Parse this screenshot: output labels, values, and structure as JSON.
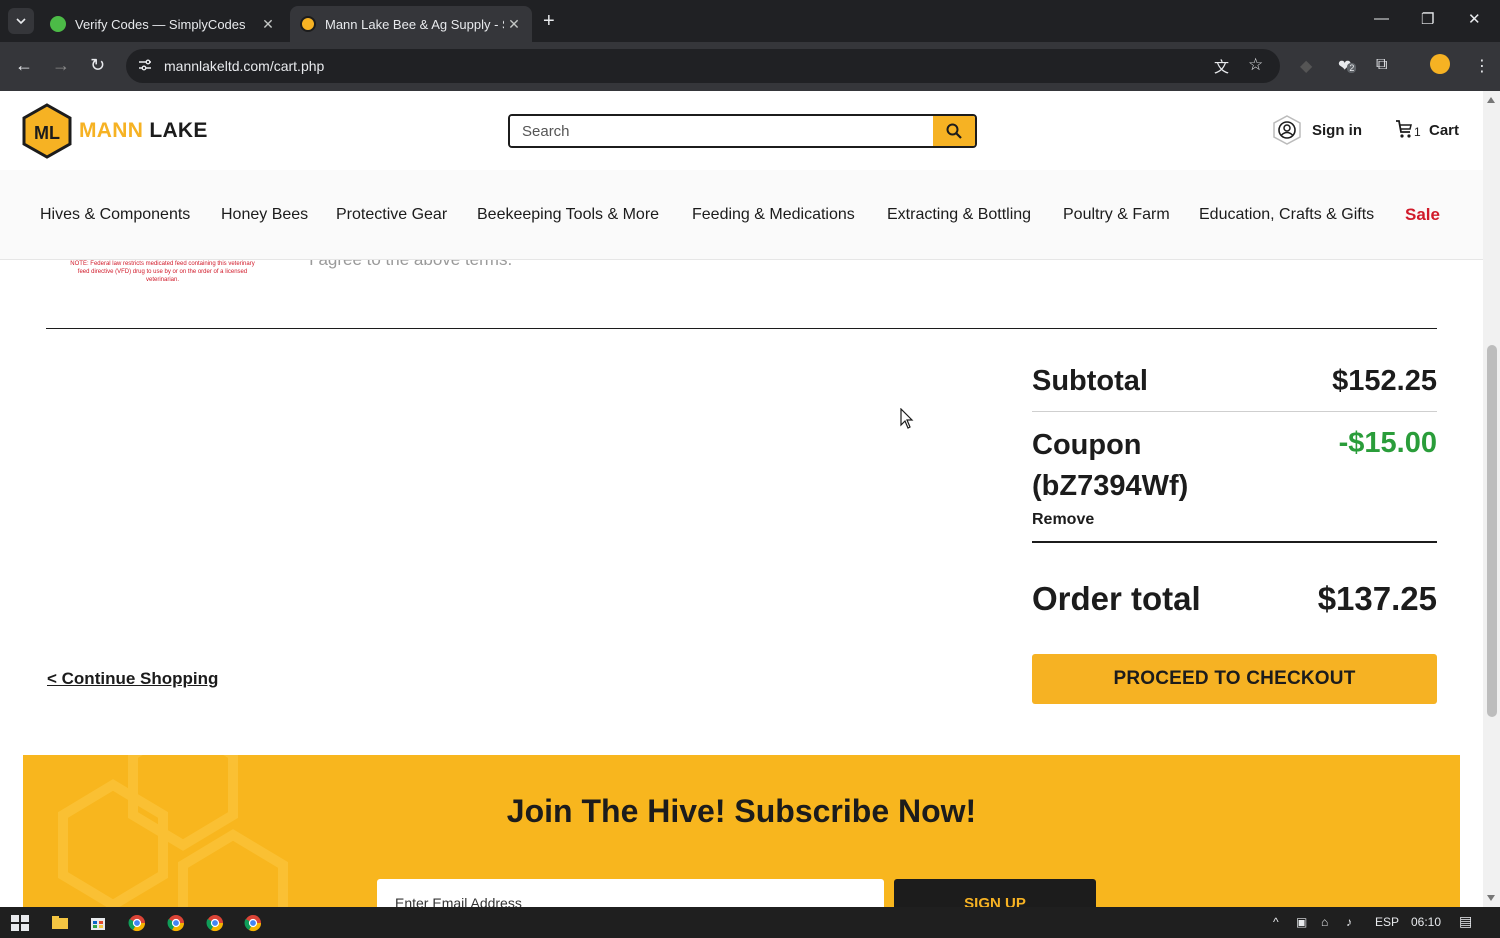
{
  "browser": {
    "tabs": [
      {
        "title": "Verify Codes — SimplyCodes",
        "favicon": "simplycodes-icon"
      },
      {
        "title": "Mann Lake Bee & Ag Supply - S",
        "favicon": "mannlake-icon"
      }
    ],
    "url": "mannlakeltd.com/cart.php",
    "extension_badge": "2"
  },
  "header": {
    "logo_initials": "ML",
    "logo_mann": "MANN",
    "logo_lake": "LAKE",
    "search_placeholder": "Search",
    "sign_in": "Sign in",
    "cart_label": "Cart",
    "cart_count": "1"
  },
  "nav": {
    "items": [
      "Hives & Components",
      "Honey Bees",
      "Protective Gear",
      "Beekeeping Tools & More",
      "Feeding & Medications",
      "Extracting & Bottling",
      "Poultry & Farm",
      "Education, Crafts & Gifts"
    ],
    "sale": "Sale"
  },
  "cart": {
    "vfd_note": "NOTE: Federal law restricts medicated feed containing this veterinary feed directive (VFD) drug to use by or on the order of a licensed veterinarian.",
    "agree_text": "I agree to the above terms.",
    "subtotal_label": "Subtotal",
    "subtotal_value": "$152.25",
    "coupon_label": "Coupon (bZ7394Wf)",
    "coupon_value": "-$15.00",
    "remove_label": "Remove",
    "order_total_label": "Order total",
    "order_total_value": "$137.25",
    "checkout_label": "PROCEED TO CHECKOUT",
    "continue_label": "< Continue Shopping"
  },
  "newsletter": {
    "title": "Join The Hive! Subscribe Now!",
    "email_placeholder": "Enter Email Address",
    "signup_label": "SIGN UP"
  },
  "taskbar": {
    "language": "ESP",
    "time": "06:10"
  },
  "colors": {
    "brand_yellow": "#f6b223",
    "sale_red": "#d11a2a",
    "coupon_green": "#2a9d3a",
    "dark": "#1c1c1c"
  }
}
